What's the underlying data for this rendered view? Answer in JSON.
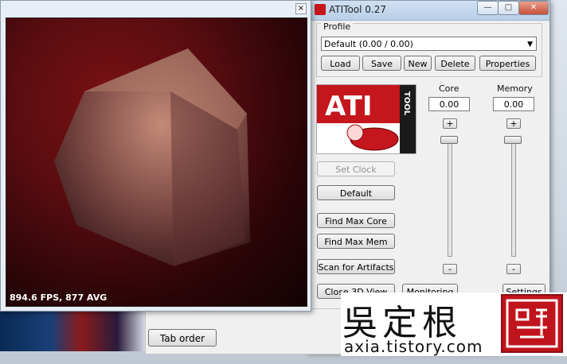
{
  "ati_window": {
    "title": "ATITool 0.27",
    "profile": {
      "group_label": "Profile",
      "selected": "Default (0.00 / 0.00)",
      "buttons": [
        "Load",
        "Save",
        "New",
        "Delete",
        "Properties"
      ]
    },
    "logo": {
      "brand": "ATI",
      "tagline": "TOOL"
    },
    "core": {
      "label": "Core",
      "value": "0.00"
    },
    "memory": {
      "label": "Memory",
      "value": "0.00"
    },
    "sliders": {
      "core_level": 0.0,
      "memory_level": 0.0
    },
    "actions": {
      "set_clock": "Set Clock",
      "default": "Default",
      "find_max_core": "Find Max Core",
      "find_max_mem": "Find Max Mem",
      "scan_artifacts": "Scan for Artifacts",
      "close_3d_view": "Close 3D View",
      "monitoring": "Monitoring",
      "settings": "Settings"
    }
  },
  "view_window": {
    "close_glyph": "×",
    "fps_text": "894.6 FPS, 877 AVG"
  },
  "bottom": {
    "tab_order": "Tab order"
  },
  "watermark": {
    "chinese": "吳定根",
    "url": "axia.tistory.com"
  },
  "colors": {
    "ati_red": "#c4161c",
    "canvas_bg": "#5a0d10"
  }
}
